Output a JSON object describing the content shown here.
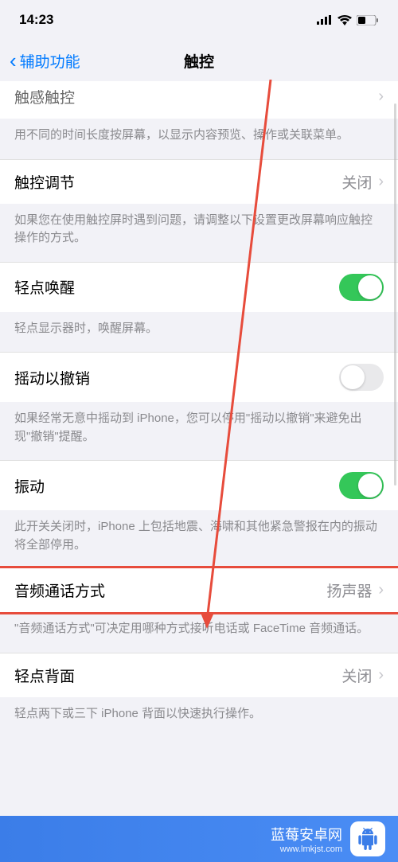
{
  "statusBar": {
    "time": "14:23"
  },
  "nav": {
    "back": "辅助功能",
    "title": "触控"
  },
  "rows": {
    "partialTop": {
      "label": "触感触控"
    },
    "partialFooter": "用不同的时间长度按屏幕，以显示内容预览、操作或关联菜单。",
    "touchAdjust": {
      "label": "触控调节",
      "value": "关闭"
    },
    "touchAdjustFooter": "如果您在使用触控屏时遇到问题，请调整以下设置更改屏幕响应触控操作的方式。",
    "tapToWake": {
      "label": "轻点唤醒",
      "on": true
    },
    "tapToWakeFooter": "轻点显示器时，唤醒屏幕。",
    "shakeUndo": {
      "label": "摇动以撤销",
      "on": false
    },
    "shakeUndoFooter": "如果经常无意中摇动到 iPhone，您可以停用\"摇动以撤销\"来避免出现\"撤销\"提醒。",
    "vibration": {
      "label": "振动",
      "on": true
    },
    "vibrationFooter": "此开关关闭时，iPhone 上包括地震、海啸和其他紧急警报在内的振动将全部停用。",
    "audioCall": {
      "label": "音频通话方式",
      "value": "扬声器"
    },
    "audioCallFooter": "\"音频通话方式\"可决定用哪种方式接听电话或 FaceTime 音频通话。",
    "backTap": {
      "label": "轻点背面",
      "value": "关闭"
    },
    "backTapFooter": "轻点两下或三下 iPhone 背面以快速执行操作。"
  },
  "watermark": {
    "main": "蓝莓安卓网",
    "sub": "www.lmkjst.com"
  }
}
